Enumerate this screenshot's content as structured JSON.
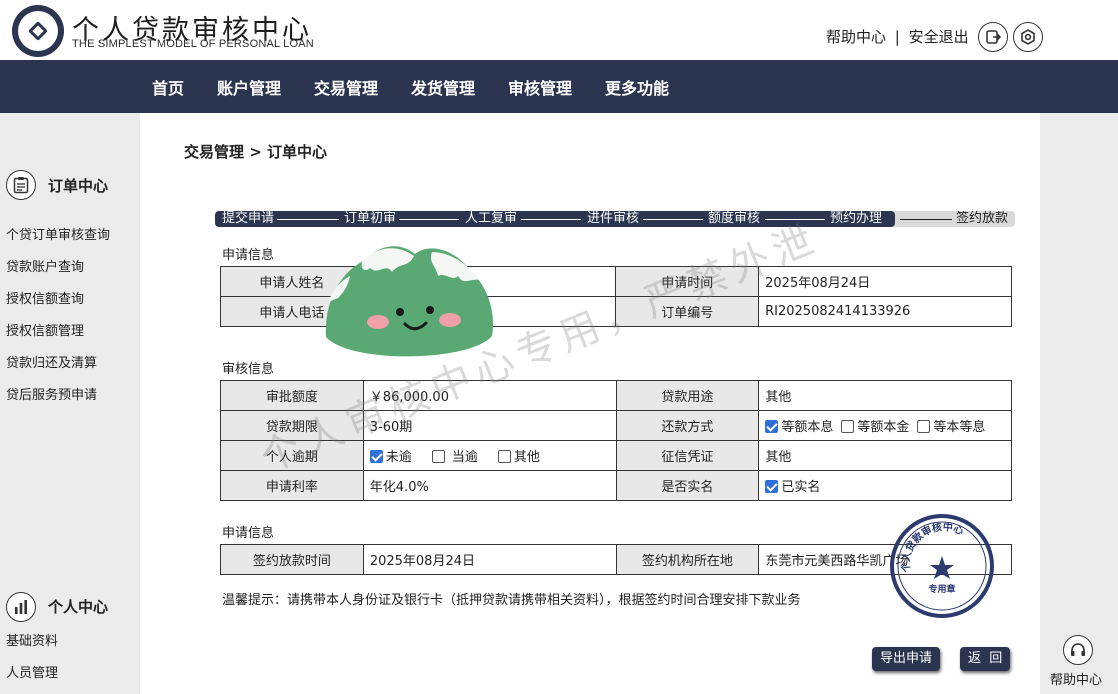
{
  "header": {
    "title": "个人贷款审核中心",
    "subtitle": "THE SIMPLEST MODEL OF PERSONAL LOAN",
    "help_link": "帮助中心",
    "separator": "|",
    "logout_link": "安全退出"
  },
  "nav": {
    "items": [
      "首页",
      "账户管理",
      "交易管理",
      "发货管理",
      "审核管理",
      "更多功能"
    ]
  },
  "sidebar": {
    "section1_title": "订单中心",
    "section1_items": [
      "个贷订单审核查询",
      "贷款账户查询",
      "授权信额查询",
      "授权信额管理",
      "贷款归还及清算",
      "贷后服务预申请"
    ],
    "section2_title": "个人中心",
    "section2_items": [
      "基础资料",
      "人员管理"
    ]
  },
  "main": {
    "breadcrumb": "交易管理 > 订单中心",
    "steps": [
      "提交申请",
      "订单初审",
      "人工复审",
      "进件审核",
      "额度审核",
      "预约办理",
      "签约放款"
    ],
    "completed_steps": 6,
    "section_applicant": {
      "title": "申请信息",
      "name_label": "申请人姓名",
      "name_value": "",
      "time_label": "申请时间",
      "time_value": "2025年08月24日",
      "phone_label": "申请人电话",
      "phone_value": "",
      "order_label": "订单编号",
      "order_value": "RI2025082414133926"
    },
    "section_review": {
      "title": "审核信息",
      "amount_label": "审批额度",
      "amount_value": "￥86,000.00",
      "purpose_label": "贷款用途",
      "purpose_value": "其他",
      "term_label": "贷款期限",
      "term_value": "3-60期",
      "repay_label": "还款方式",
      "repay_options": [
        {
          "label": "等额本息",
          "checked": true
        },
        {
          "label": "等额本金",
          "checked": false
        },
        {
          "label": "等本等息",
          "checked": false
        }
      ],
      "overdue_label": "个人逾期",
      "overdue_options": [
        {
          "label": "未逾",
          "checked": true
        },
        {
          "label": "当逾",
          "checked": false
        },
        {
          "label": "其他",
          "checked": false
        }
      ],
      "credit_label": "征信凭证",
      "credit_value": "其他",
      "rate_label": "申请利率",
      "rate_value": "年化4.0%",
      "realname_label": "是否实名",
      "realname_option": {
        "label": "已实名",
        "checked": true
      }
    },
    "section_sign": {
      "title": "申请信息",
      "time_label": "签约放款时间",
      "time_value": "2025年08月24日",
      "location_label": "签约机构所在地",
      "location_value": "东莞市元美西路华凯广场"
    },
    "tip": "温馨提示：请携带本人身份证及银行卡（抵押贷款请携带相关资料），根据签约时间合理安排下款业务",
    "export_button": "导出申请",
    "back_button": "返  回"
  },
  "watermark": "个人审核中心专用，严禁外泄",
  "seal": {
    "ring_text": "个人贷款审核中心",
    "center_text": "专用章"
  },
  "help_corner": "帮助中心",
  "colors": {
    "primary": "#2b3550",
    "checkbox": "#2f6fd9",
    "label_bg": "#e8e8e8",
    "page_bg": "#ebebeb"
  }
}
